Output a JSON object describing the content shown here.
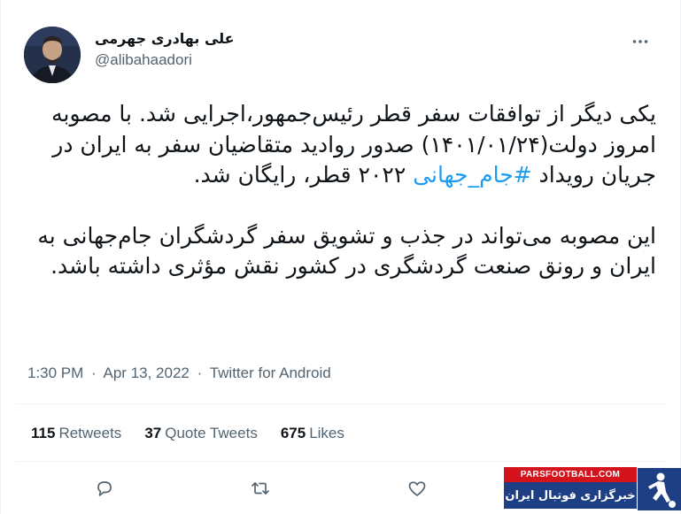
{
  "author": {
    "display_name": "علی بهادری جهرمی",
    "handle": "@alibahaadori",
    "avatar_icon": "profile-photo"
  },
  "menu": {
    "more_icon": "more-horizontal-icon"
  },
  "tweet": {
    "paragraph1_part1": "یکی دیگر از توافقات سفر قطر رئیس‌جمهور،اجرایی شد. با مصوبه امروز دولت(۱۴۰۱/۰۱/۲۴) صدور روادید متقاضیان سفر به ایران در جریان رویداد ",
    "hashtag": "#جام_جهانی",
    "paragraph1_part2": " ۲۰۲۲ قطر، رایگان شد.",
    "paragraph2": "این مصوبه می‌تواند در جذب و تشویق سفر گردشگران جام‌جهانی به ایران و رونق صنعت گردشگری در کشور نقش مؤثری داشته باشد."
  },
  "meta": {
    "time": "1:30 PM",
    "date": "Apr 13, 2022",
    "separator": "·",
    "source": "Twitter for Android"
  },
  "stats": {
    "retweets_count": "115",
    "retweets_label": "Retweets",
    "quotes_count": "37",
    "quotes_label": "Quote Tweets",
    "likes_count": "675",
    "likes_label": "Likes"
  },
  "actions": [
    "reply-icon",
    "retweet-icon",
    "like-icon",
    "share-icon"
  ],
  "watermark": {
    "site": "PARSFOOTBALL.COM",
    "tagline": "خبرگزاری فوتبال ایران"
  },
  "colors": {
    "link": "#1d9bf0",
    "secondary_text": "#536471",
    "watermark_red": "#d5131c",
    "watermark_blue": "#1f3f85"
  }
}
